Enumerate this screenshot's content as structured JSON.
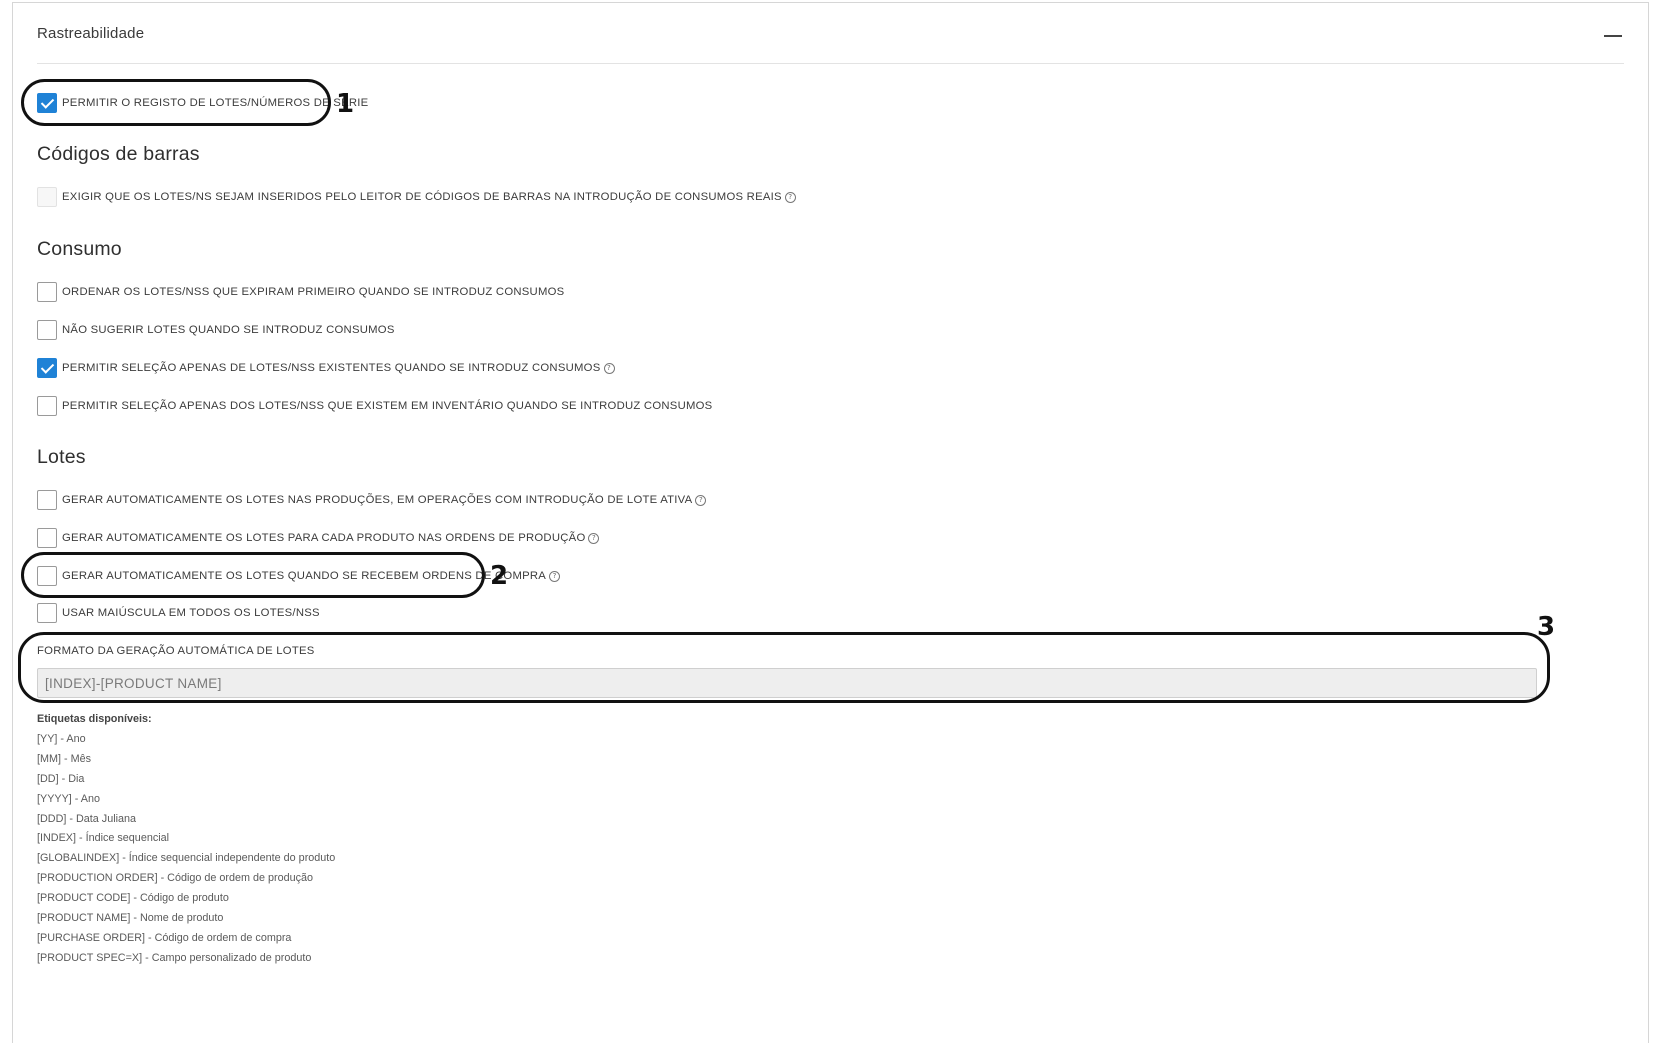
{
  "panel": {
    "title": "Rastreabilidade",
    "collapse_icon": "minus-icon"
  },
  "main_option": {
    "label": "PERMITIR O REGISTO DE LOTES/NÚMEROS DE SÉRIE",
    "checked": true
  },
  "sections": {
    "barcodes": {
      "title": "Códigos de barras",
      "option": {
        "label": "EXIGIR QUE OS LOTES/NS SEJAM INSERIDOS PELO LEITOR DE CÓDIGOS DE BARRAS NA INTRODUÇÃO DE CONSUMOS REAIS",
        "checked": false,
        "disabled": true,
        "help_icon": "question-circle-icon"
      }
    },
    "consumption": {
      "title": "Consumo",
      "options": [
        {
          "label": "ORDENAR OS LOTES/NSS QUE EXPIRAM PRIMEIRO QUANDO SE INTRODUZ CONSUMOS",
          "checked": false
        },
        {
          "label": "NÃO SUGERIR LOTES QUANDO SE INTRODUZ CONSUMOS",
          "checked": false
        },
        {
          "label": "PERMITIR SELEÇÃO APENAS DE LOTES/NSS EXISTENTES QUANDO SE INTRODUZ CONSUMOS",
          "checked": true,
          "help_icon": "question-circle-icon"
        },
        {
          "label": "PERMITIR SELEÇÃO APENAS DOS LOTES/NSS QUE EXISTEM EM INVENTÁRIO QUANDO SE INTRODUZ CONSUMOS",
          "checked": false
        }
      ]
    },
    "lots": {
      "title": "Lotes",
      "options": [
        {
          "label": "GERAR AUTOMATICAMENTE OS LOTES NAS PRODUÇÕES, EM OPERAÇÕES COM INTRODUÇÃO DE LOTE ATIVA",
          "checked": false,
          "help_icon": "question-circle-icon"
        },
        {
          "label": "GERAR AUTOMATICAMENTE OS LOTES PARA CADA PRODUTO NAS ORDENS DE PRODUÇÃO",
          "checked": false,
          "help_icon": "question-circle-icon"
        },
        {
          "label": "GERAR AUTOMATICAMENTE OS LOTES QUANDO SE RECEBEM ORDENS DE COMPRA",
          "checked": false,
          "help_icon": "question-circle-icon"
        },
        {
          "label": "USAR MAIÚSCULA EM TODOS OS LOTES/NSS",
          "checked": false
        }
      ],
      "format_label": "FORMATO DA GERAÇÃO AUTOMÁTICA DE LOTES",
      "format_value": "[INDEX]-[PRODUCT NAME]"
    }
  },
  "tags": {
    "title": "Etiquetas disponíveis:",
    "items": [
      "[YY] - Ano",
      "[MM] - Mês",
      "[DD] - Dia",
      "[YYYY] - Ano",
      "[DDD] - Data Juliana",
      "[INDEX] - Índice sequencial",
      "[GLOBALINDEX] - Índice sequencial independente do produto",
      "[PRODUCTION ORDER] - Código de ordem de produção",
      "[PRODUCT CODE] - Código de produto",
      "[PRODUCT NAME] - Nome de produto",
      "[PURCHASE ORDER] - Código de ordem de compra",
      "[PRODUCT SPEC=X] - Campo personalizado de produto"
    ]
  },
  "callouts": [
    "1",
    "2",
    "3"
  ],
  "colors": {
    "accent": "#1f82d6",
    "callout": "#111111"
  }
}
